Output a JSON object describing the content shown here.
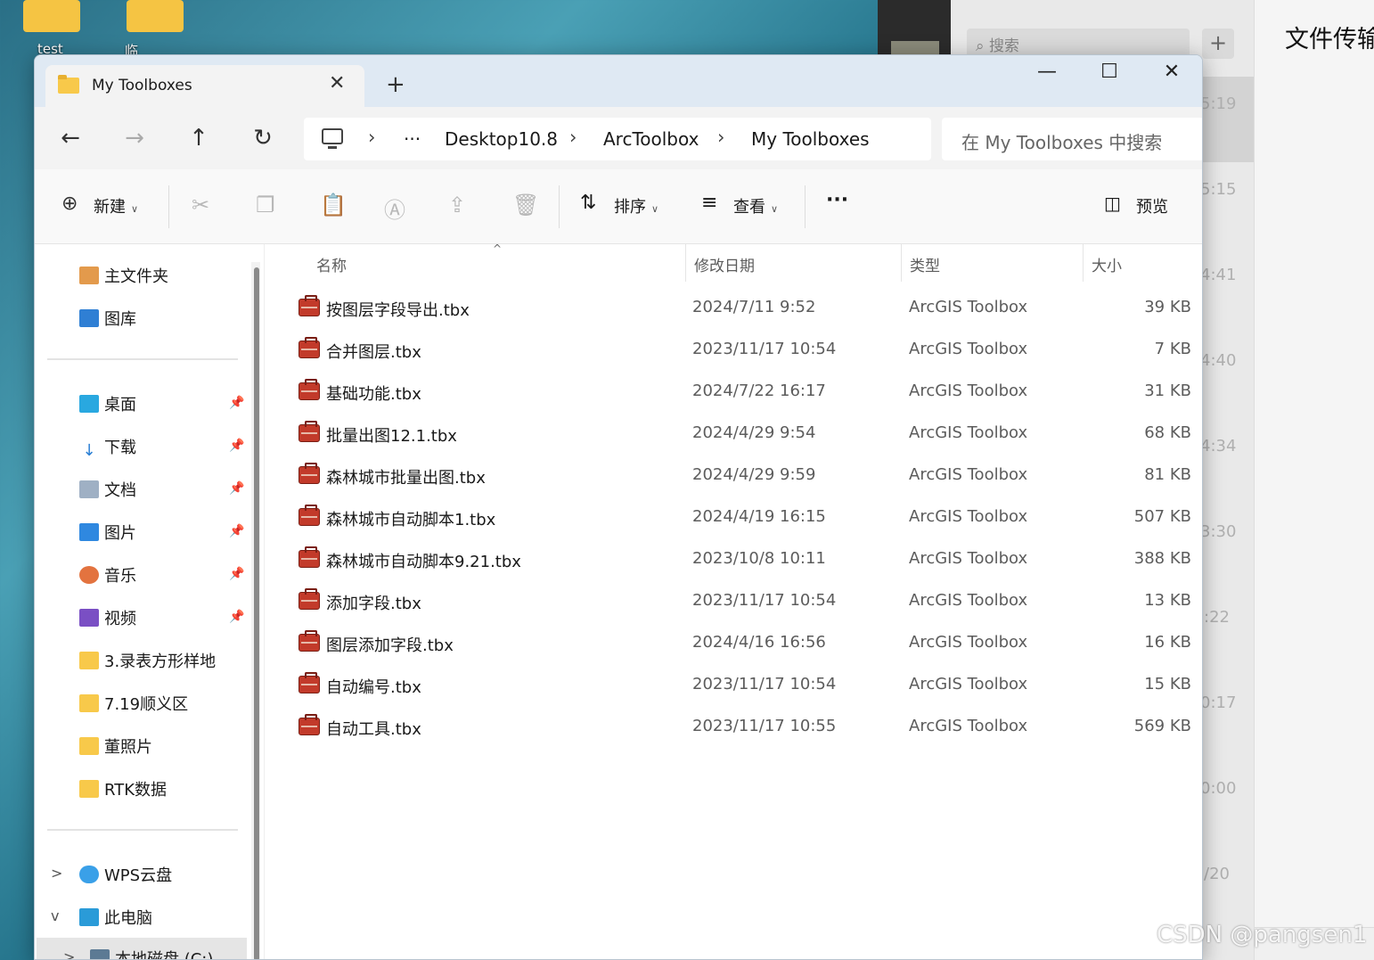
{
  "desktop": {
    "icons": [
      {
        "label": "test",
        "color": "#3aa655"
      },
      {
        "label": "临时文件",
        "color": "#e04a3a"
      }
    ]
  },
  "chat_app": {
    "search_placeholder": "搜索",
    "plus_label": "+",
    "times": [
      "5:19",
      "5:15",
      "4:41",
      "4:40",
      "4:34",
      "3:30",
      ":22",
      "0:17",
      "0:00",
      "/20"
    ],
    "title": "文件传输"
  },
  "watermark": "CSDN @pangsen1",
  "explorer": {
    "tab_title": "My Toolboxes",
    "window_controls": {
      "minimize": "—",
      "maximize": "☐",
      "close": "✕"
    },
    "address": {
      "ellipsis": "···",
      "segments": [
        "Desktop10.8",
        "ArcToolbox",
        "My Toolboxes"
      ]
    },
    "search_placeholder": "在 My Toolboxes 中搜索",
    "toolbar": {
      "new_label": "新建",
      "sort_label": "排序",
      "view_label": "查看",
      "more_label": "···",
      "preview_label": "预览"
    },
    "sidebar": {
      "top": [
        {
          "label": "主文件夹",
          "icon": "home-icon"
        },
        {
          "label": "图库",
          "icon": "gallery-icon"
        }
      ],
      "pinned": [
        {
          "label": "桌面",
          "icon": "desktop-icon",
          "pinned": true
        },
        {
          "label": "下载",
          "icon": "download-icon",
          "pinned": true
        },
        {
          "label": "文档",
          "icon": "document-icon",
          "pinned": true
        },
        {
          "label": "图片",
          "icon": "pictures-icon",
          "pinned": true
        },
        {
          "label": "音乐",
          "icon": "music-icon",
          "pinned": true
        },
        {
          "label": "视频",
          "icon": "video-icon",
          "pinned": true
        },
        {
          "label": "3.录表方形样地",
          "icon": "folder-icon",
          "pinned": false
        },
        {
          "label": "7.19顺义区",
          "icon": "folder-icon",
          "pinned": false
        },
        {
          "label": "董照片",
          "icon": "folder-icon",
          "pinned": false
        },
        {
          "label": "RTK数据",
          "icon": "folder-icon",
          "pinned": false
        }
      ],
      "bottom": [
        {
          "label": "WPS云盘",
          "icon": "cloud-icon",
          "expander": ">"
        },
        {
          "label": "此电脑",
          "icon": "computer-icon",
          "expander": "v"
        },
        {
          "label": "本地磁盘 (C:)",
          "icon": "drive-icon",
          "expander": ">"
        }
      ]
    },
    "columns": {
      "name": "名称",
      "modified": "修改日期",
      "type": "类型",
      "size": "大小"
    },
    "files": [
      {
        "name": "按图层字段导出.tbx",
        "modified": "2024/7/11 9:52",
        "type": "ArcGIS Toolbox",
        "size": "39 KB"
      },
      {
        "name": "合并图层.tbx",
        "modified": "2023/11/17 10:54",
        "type": "ArcGIS Toolbox",
        "size": "7 KB"
      },
      {
        "name": "基础功能.tbx",
        "modified": "2024/7/22 16:17",
        "type": "ArcGIS Toolbox",
        "size": "31 KB"
      },
      {
        "name": "批量出图12.1.tbx",
        "modified": "2024/4/29 9:54",
        "type": "ArcGIS Toolbox",
        "size": "68 KB"
      },
      {
        "name": "森林城市批量出图.tbx",
        "modified": "2024/4/29 9:59",
        "type": "ArcGIS Toolbox",
        "size": "81 KB"
      },
      {
        "name": "森林城市自动脚本1.tbx",
        "modified": "2024/4/19 16:15",
        "type": "ArcGIS Toolbox",
        "size": "507 KB"
      },
      {
        "name": "森林城市自动脚本9.21.tbx",
        "modified": "2023/10/8 10:11",
        "type": "ArcGIS Toolbox",
        "size": "388 KB"
      },
      {
        "name": "添加字段.tbx",
        "modified": "2023/11/17 10:54",
        "type": "ArcGIS Toolbox",
        "size": "13 KB"
      },
      {
        "name": "图层添加字段.tbx",
        "modified": "2024/4/16 16:56",
        "type": "ArcGIS Toolbox",
        "size": "16 KB"
      },
      {
        "name": "自动编号.tbx",
        "modified": "2023/11/17 10:54",
        "type": "ArcGIS Toolbox",
        "size": "15 KB"
      },
      {
        "name": "自动工具.tbx",
        "modified": "2023/11/17 10:55",
        "type": "ArcGIS Toolbox",
        "size": "569 KB"
      }
    ]
  }
}
